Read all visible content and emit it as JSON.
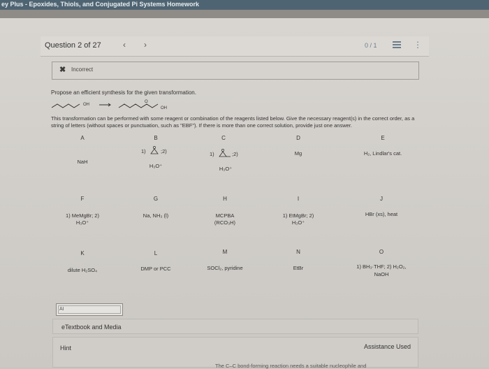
{
  "window": {
    "title": "ey Plus - Epoxides, Thiols, and Conjugated Pi Systems Homework"
  },
  "question": {
    "title": "Question 2 of 27",
    "score": "0 / 1"
  },
  "feedback": {
    "label": "Incorrect"
  },
  "problem": {
    "prompt": "Propose an efficient synthesis for the given transformation.",
    "start_oh": "OH",
    "product_o": "O",
    "product_oh": "OH",
    "instructions": "This transformation can be performed with some reagent or combination of the reagents listed below. Give the necessary reagent(s) in the correct order, as a string of letters (without spaces or punctuation, such as \"EBF\"). If there is more than one correct solution, provide just one answer."
  },
  "reagents": [
    {
      "letter": "A",
      "text": "NaH"
    },
    {
      "letter": "B",
      "l1": "1)",
      "l1b": ";2)",
      "l2": "H₃O⁺"
    },
    {
      "letter": "C",
      "l1": "1)",
      "l1b": ";2)",
      "l2": "H₃O⁺"
    },
    {
      "letter": "D",
      "text": "Mg"
    },
    {
      "letter": "E",
      "text": "H₂, Lindlar's cat."
    },
    {
      "letter": "F",
      "l1": "1) MeMgBr; 2)",
      "l2": "H₃O⁺"
    },
    {
      "letter": "G",
      "text": "Na, NH₃ (l)"
    },
    {
      "letter": "H",
      "l1": "MCPBA",
      "l2": "(RCO₃H)"
    },
    {
      "letter": "I",
      "l1": "1) EtMgBr; 2)",
      "l2": "H₃O⁺"
    },
    {
      "letter": "J",
      "text": "HBr (xs), heat"
    },
    {
      "letter": "K",
      "text": "dilute H₂SO₄"
    },
    {
      "letter": "L",
      "text": "DMP or PCC"
    },
    {
      "letter": "M",
      "text": "SOCl₂, pyridine"
    },
    {
      "letter": "N",
      "text": "EtBr"
    },
    {
      "letter": "O",
      "l1": "1) BH₃·THF; 2) H₂O₂,",
      "l2": "NaOH"
    }
  ],
  "answer": {
    "value": "AI"
  },
  "etextbook": {
    "label": "eTextbook and Media"
  },
  "hint": {
    "label": "Hint",
    "assistance": "Assistance Used",
    "cutoff_text": "The C–C bond-forming reaction needs a suitable nucleophile and"
  }
}
